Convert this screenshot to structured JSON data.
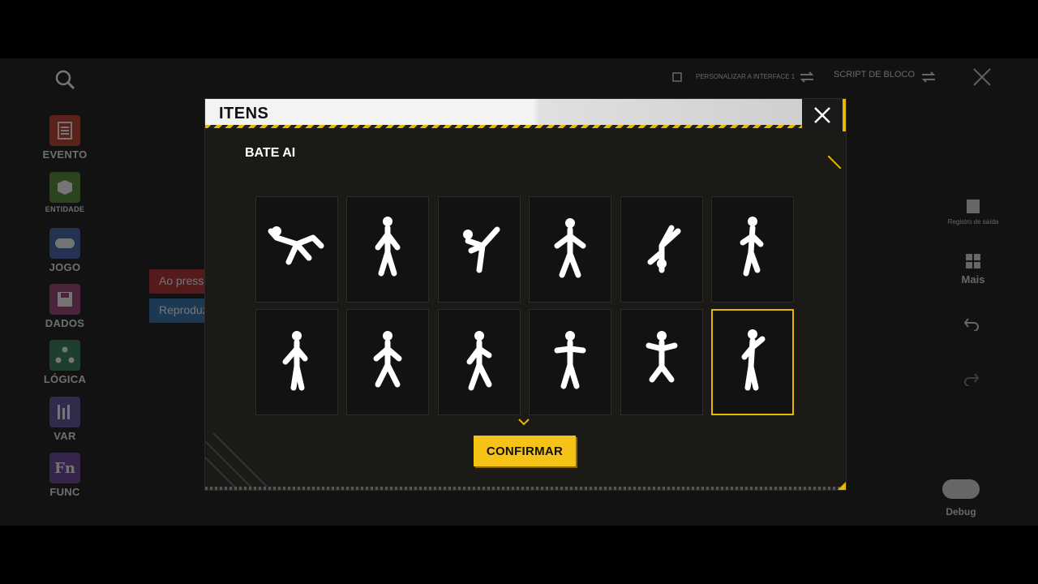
{
  "background": {
    "sidebar": [
      {
        "label": "EVENTO",
        "icon": "document-icon",
        "color": "#c0392b"
      },
      {
        "label": "ENTIDADE",
        "icon": "cube-icon",
        "color": "#4f8a2e"
      },
      {
        "label": "JOGO",
        "icon": "gamepad-icon",
        "color": "#3b5fa6"
      },
      {
        "label": "DADOS",
        "icon": "floppy-icon",
        "color": "#9a3d74"
      },
      {
        "label": "LÓGICA",
        "icon": "nodes-icon",
        "color": "#2f7d5a"
      },
      {
        "label": "VAR",
        "icon": "bars-icon",
        "color": "#5d4b9a"
      },
      {
        "label": "FUNC",
        "icon": "function-icon",
        "color": "#6a3fa0"
      }
    ],
    "top_bar": {
      "customize_label": "PERSONALIZAR A INTERFACE 1",
      "script_label": "SCRIPT DE BLOCO"
    },
    "blocks": [
      {
        "label": "Ao pressi",
        "color": "#b3262a"
      },
      {
        "label": "Reproduz",
        "color": "#2a6fb0"
      }
    ],
    "right_panel": {
      "log_label": "Registro de saída",
      "more_label": "Mais",
      "debug_label": "Debug"
    }
  },
  "modal": {
    "title": "ITENS",
    "subtitle": "BATE AI",
    "confirm_label": "CONFIRMAR",
    "selected_index": 11,
    "accent": "#e6b800",
    "items": [
      {
        "icon": "emote-flip-icon"
      },
      {
        "icon": "emote-stand-icon"
      },
      {
        "icon": "emote-kick-icon"
      },
      {
        "icon": "emote-pose-icon"
      },
      {
        "icon": "emote-handstand-icon"
      },
      {
        "icon": "emote-dance-girl-icon"
      },
      {
        "icon": "emote-point-icon"
      },
      {
        "icon": "emote-crouch-icon"
      },
      {
        "icon": "emote-walk-icon"
      },
      {
        "icon": "emote-music-icon"
      },
      {
        "icon": "emote-kneel-icon"
      },
      {
        "icon": "emote-wave-icon"
      }
    ]
  }
}
